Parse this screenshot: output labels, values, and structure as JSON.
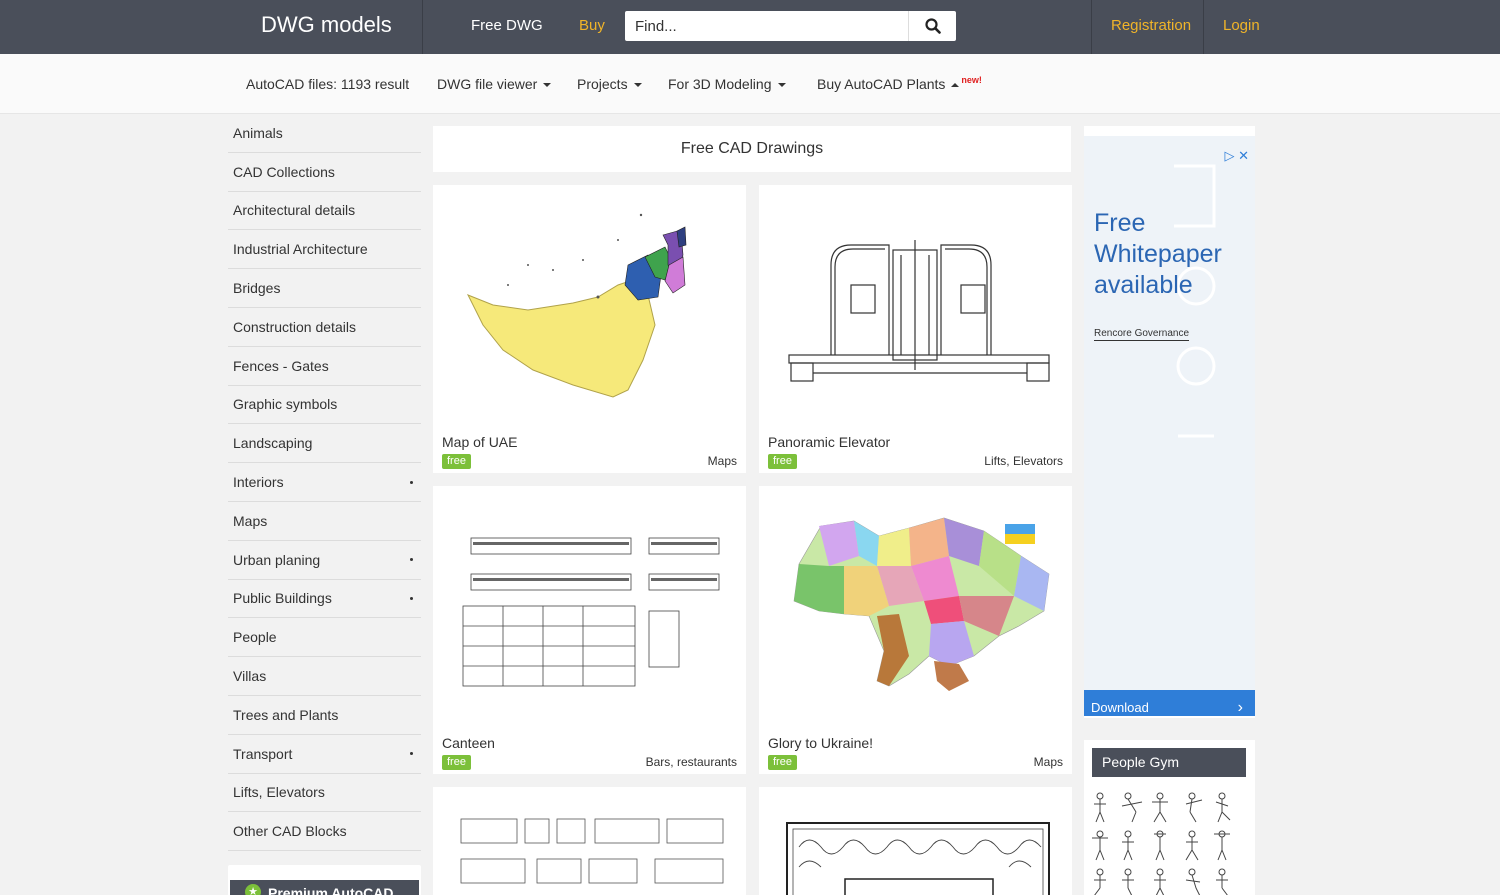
{
  "header": {
    "brand": "DWG models",
    "free_dwg": "Free DWG",
    "buy": "Buy",
    "search_placeholder": "Find...",
    "registration": "Registration",
    "login": "Login"
  },
  "subnav": {
    "files": "AutoCAD files: 1193 result",
    "viewer": "DWG file viewer",
    "projects": "Projects",
    "modeling": "For 3D Modeling",
    "plants": "Buy AutoCAD Plants",
    "new": "new!"
  },
  "sidebar": {
    "items": [
      {
        "label": "Animals"
      },
      {
        "label": "CAD Collections"
      },
      {
        "label": "Architectural details"
      },
      {
        "label": "Industrial Architecture"
      },
      {
        "label": "Bridges"
      },
      {
        "label": "Construction details"
      },
      {
        "label": "Fences - Gates"
      },
      {
        "label": "Graphic symbols"
      },
      {
        "label": "Landscaping"
      },
      {
        "label": "Interiors"
      },
      {
        "label": "Maps"
      },
      {
        "label": "Urban planing"
      },
      {
        "label": "Public Buildings"
      },
      {
        "label": "People"
      },
      {
        "label": "Villas"
      },
      {
        "label": "Trees and Plants"
      },
      {
        "label": "Transport"
      },
      {
        "label": "Lifts, Elevators"
      },
      {
        "label": "Other CAD Blocks"
      }
    ],
    "premium": "Premium AutoCAD"
  },
  "main": {
    "title": "Free CAD Drawings",
    "cards": [
      {
        "title": "Map of UAE",
        "badge": "free",
        "category": "Maps"
      },
      {
        "title": "Panoramic Elevator",
        "badge": "free",
        "category": "Lifts, Elevators"
      },
      {
        "title": "Canteen",
        "badge": "free",
        "category": "Bars, restaurants"
      },
      {
        "title": "Glory to Ukraine!",
        "badge": "free",
        "category": "Maps"
      }
    ]
  },
  "ad": {
    "headline": "Free Whitepaper available",
    "sponsor": "Rencore Governance",
    "download": "Download"
  },
  "gym": {
    "title": "People Gym"
  }
}
